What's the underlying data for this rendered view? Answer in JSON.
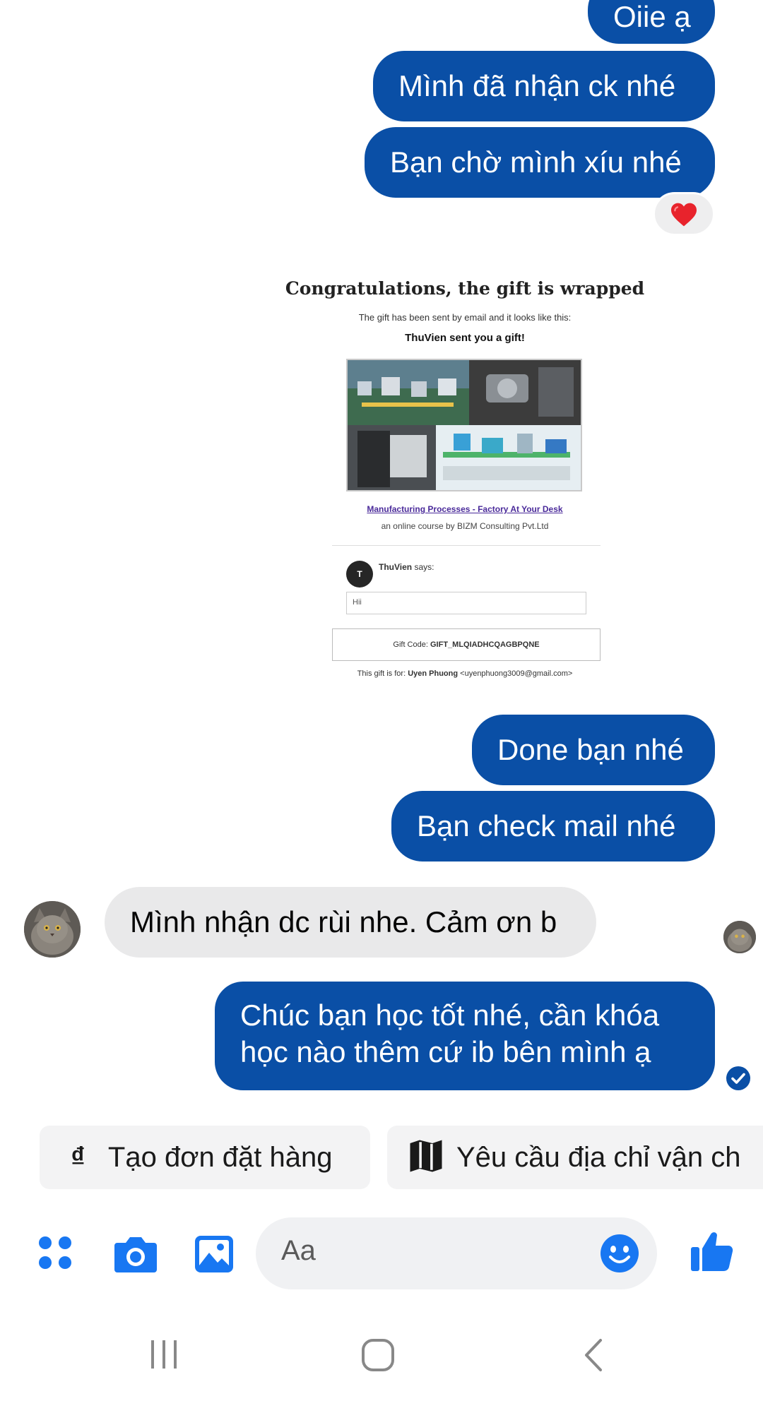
{
  "messages": {
    "m0": "Oiie ạ",
    "m1": "Mình đã nhận ck nhé",
    "m2": "Bạn chờ mình xíu nhé",
    "m3": "Done bạn nhé",
    "m4": "Bạn check mail nhé",
    "m5": "Mình nhận dc rùi nhe. Cảm ơn b",
    "m6_line1": "Chúc bạn học tốt nhé, cần khóa",
    "m6_line2": "học nào thêm cứ ib bên mình ạ"
  },
  "reaction": "heart-icon",
  "gift_card": {
    "title": "Congratulations, the gift is wrapped",
    "subtitle": "The gift has been sent by email and it looks like this:",
    "sent_line": "ThuVien sent you a gift!",
    "course_title": "Manufacturing Processes - Factory At Your Desk",
    "byline": "an online course by BIZM Consulting Pvt.Ltd",
    "avatar_letter": "T",
    "sender_name": "ThuVien",
    "says": "says:",
    "message": "Hii",
    "code_label": "Gift Code:",
    "code_value": "GIFT_MLQIADHCQAGBPQNE",
    "for_label": "This gift is for:",
    "recipient_name": "Uyen Phuong",
    "recipient_email": "<uyenphuong3009@gmail.com>"
  },
  "quick_replies": {
    "order_icon": "₫",
    "order_label": "Tạo đơn đặt hàng",
    "address_label": "Yêu cầu địa chỉ vận ch"
  },
  "composer": {
    "placeholder": "Aa"
  },
  "colors": {
    "outgoing_bubble": "#0a4fa6",
    "incoming_bubble": "#e9e9ea",
    "accent_blue": "#1877f2"
  }
}
